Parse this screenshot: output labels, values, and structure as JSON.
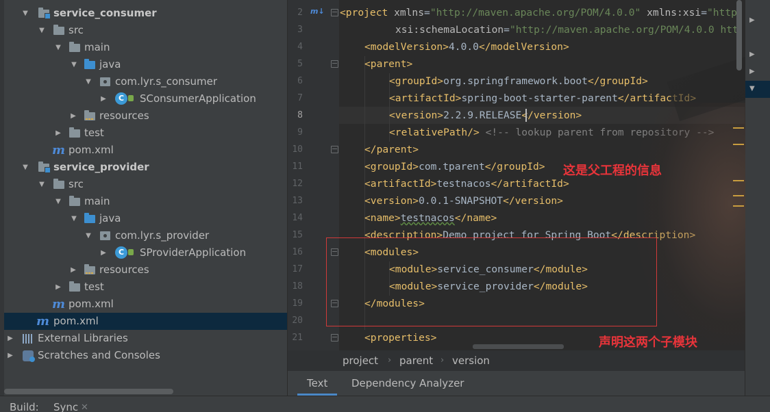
{
  "tree": {
    "items": [
      {
        "label": "service_consumer",
        "bold": true
      },
      {
        "label": "src"
      },
      {
        "label": "main"
      },
      {
        "label": "java"
      },
      {
        "label": "com.lyr.s_consumer"
      },
      {
        "label": "SConsumerApplication"
      },
      {
        "label": "resources"
      },
      {
        "label": "test"
      },
      {
        "label": "pom.xml"
      },
      {
        "label": "service_provider",
        "bold": true
      },
      {
        "label": "src"
      },
      {
        "label": "main"
      },
      {
        "label": "java"
      },
      {
        "label": "com.lyr.s_provider"
      },
      {
        "label": "SProviderApplication"
      },
      {
        "label": "resources"
      },
      {
        "label": "test"
      },
      {
        "label": "pom.xml"
      },
      {
        "label": "pom.xml",
        "selected": true
      },
      {
        "label": "External Libraries"
      },
      {
        "label": "Scratches and Consoles"
      }
    ]
  },
  "editor": {
    "line_numbers": [
      "2",
      "3",
      "4",
      "5",
      "6",
      "7",
      "8",
      "9",
      "10",
      "11",
      "12",
      "13",
      "14",
      "15",
      "16",
      "17",
      "18",
      "19",
      "20",
      "21"
    ],
    "current_line": "8",
    "lines": {
      "l2": {
        "t1": "<project ",
        "a1": "xmlns",
        "e1": "=",
        "v1": "\"http://maven.apache.org/POM/4.0.0\"",
        "a2": " xmlns:xsi",
        "e2": "=",
        "v2": "\"http"
      },
      "l3": {
        "a1": "xsi:schemaLocation",
        "e1": "=",
        "v1": "\"http://maven.apache.org/POM/4.0.0 htt"
      },
      "l4": {
        "o": "<modelVersion>",
        "x": "4.0.0",
        "c": "</modelVersion>"
      },
      "l5": {
        "o": "<parent>"
      },
      "l6": {
        "o": "<groupId>",
        "x": "org.springframework.boot",
        "c": "</groupId>"
      },
      "l7": {
        "o": "<artifactId>",
        "x": "spring-boot-starter-parent",
        "c": "</artifactId>"
      },
      "l8": {
        "o": "<version>",
        "x": "2.2.9.RELEASE",
        "c": "</version>"
      },
      "l9": {
        "o": "<relativePath/>",
        "cm": " <!-- lookup parent from repository -->"
      },
      "l10": {
        "o": "</parent>"
      },
      "l11": {
        "o": "<groupId>",
        "x": "com.tparent",
        "c": "</groupId>"
      },
      "l12": {
        "o": "<artifactId>",
        "x": "testnacos",
        "c": "</artifactId>"
      },
      "l13": {
        "o": "<version>",
        "x": "0.0.1-SNAPSHOT",
        "c": "</version>"
      },
      "l14": {
        "o": "<name>",
        "x": "testnacos",
        "c": "</name>"
      },
      "l15": {
        "o": "<description>",
        "x": "Demo project for Spring Boot",
        "c": "</description>"
      },
      "l16": {
        "o": "<modules>"
      },
      "l17": {
        "o": "<module>",
        "x": "service_consumer",
        "c": "</module>"
      },
      "l18": {
        "o": "<module>",
        "x": "service_provider",
        "c": "</module>"
      },
      "l19": {
        "o": "</modules>"
      },
      "l20": {},
      "l21": {
        "o": "<properties>"
      }
    }
  },
  "annotations": {
    "parent_info": "这是父工程的信息",
    "modules_note": "声明这两个子模块"
  },
  "breadcrumb": [
    "project",
    "parent",
    "version"
  ],
  "tabs": {
    "text": "Text",
    "dependency": "Dependency Analyzer"
  },
  "bottom": {
    "build": "Build:",
    "sync": "Sync"
  },
  "colors": {
    "tag": "#e8bf6a",
    "attr_value": "#6a8759",
    "comment": "#808080",
    "annotation": "#e8343a",
    "selection": "#0d293e"
  }
}
